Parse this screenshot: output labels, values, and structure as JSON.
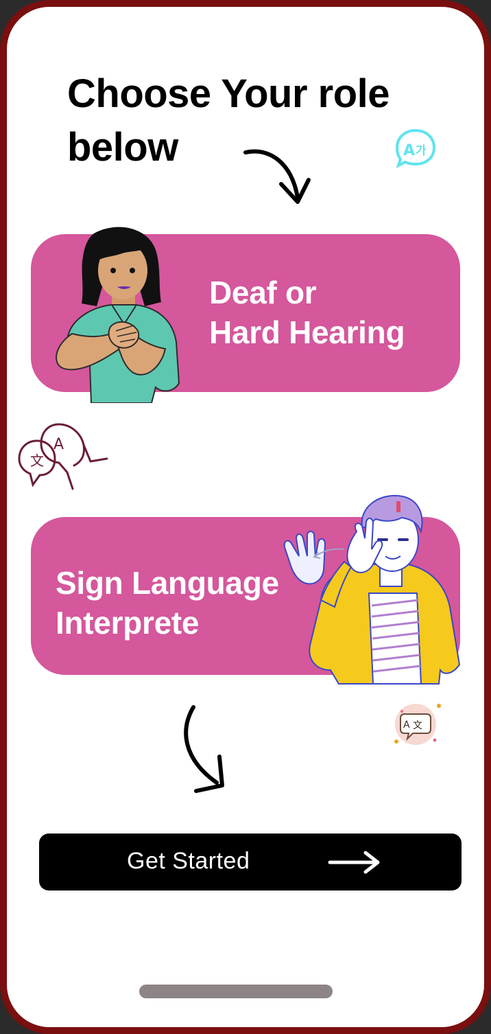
{
  "page": {
    "title_lines": [
      "Choose Your role",
      "below"
    ]
  },
  "roles": [
    {
      "label_lines": [
        "Deaf or",
        "Hard Hearing"
      ]
    },
    {
      "label_lines": [
        "Sign Language",
        "Interprete"
      ]
    }
  ],
  "cta": {
    "label": "Get Started"
  },
  "colors": {
    "frame": "#7a0f10",
    "card": "#d5579c",
    "button": "#000000",
    "home_indicator": "#8d8486"
  },
  "icons": [
    "translate-bubble-icon",
    "arrow-curve-down-icon",
    "translate-dual-bubbles-icon",
    "translate-badge-icon",
    "arrow-right-icon"
  ]
}
